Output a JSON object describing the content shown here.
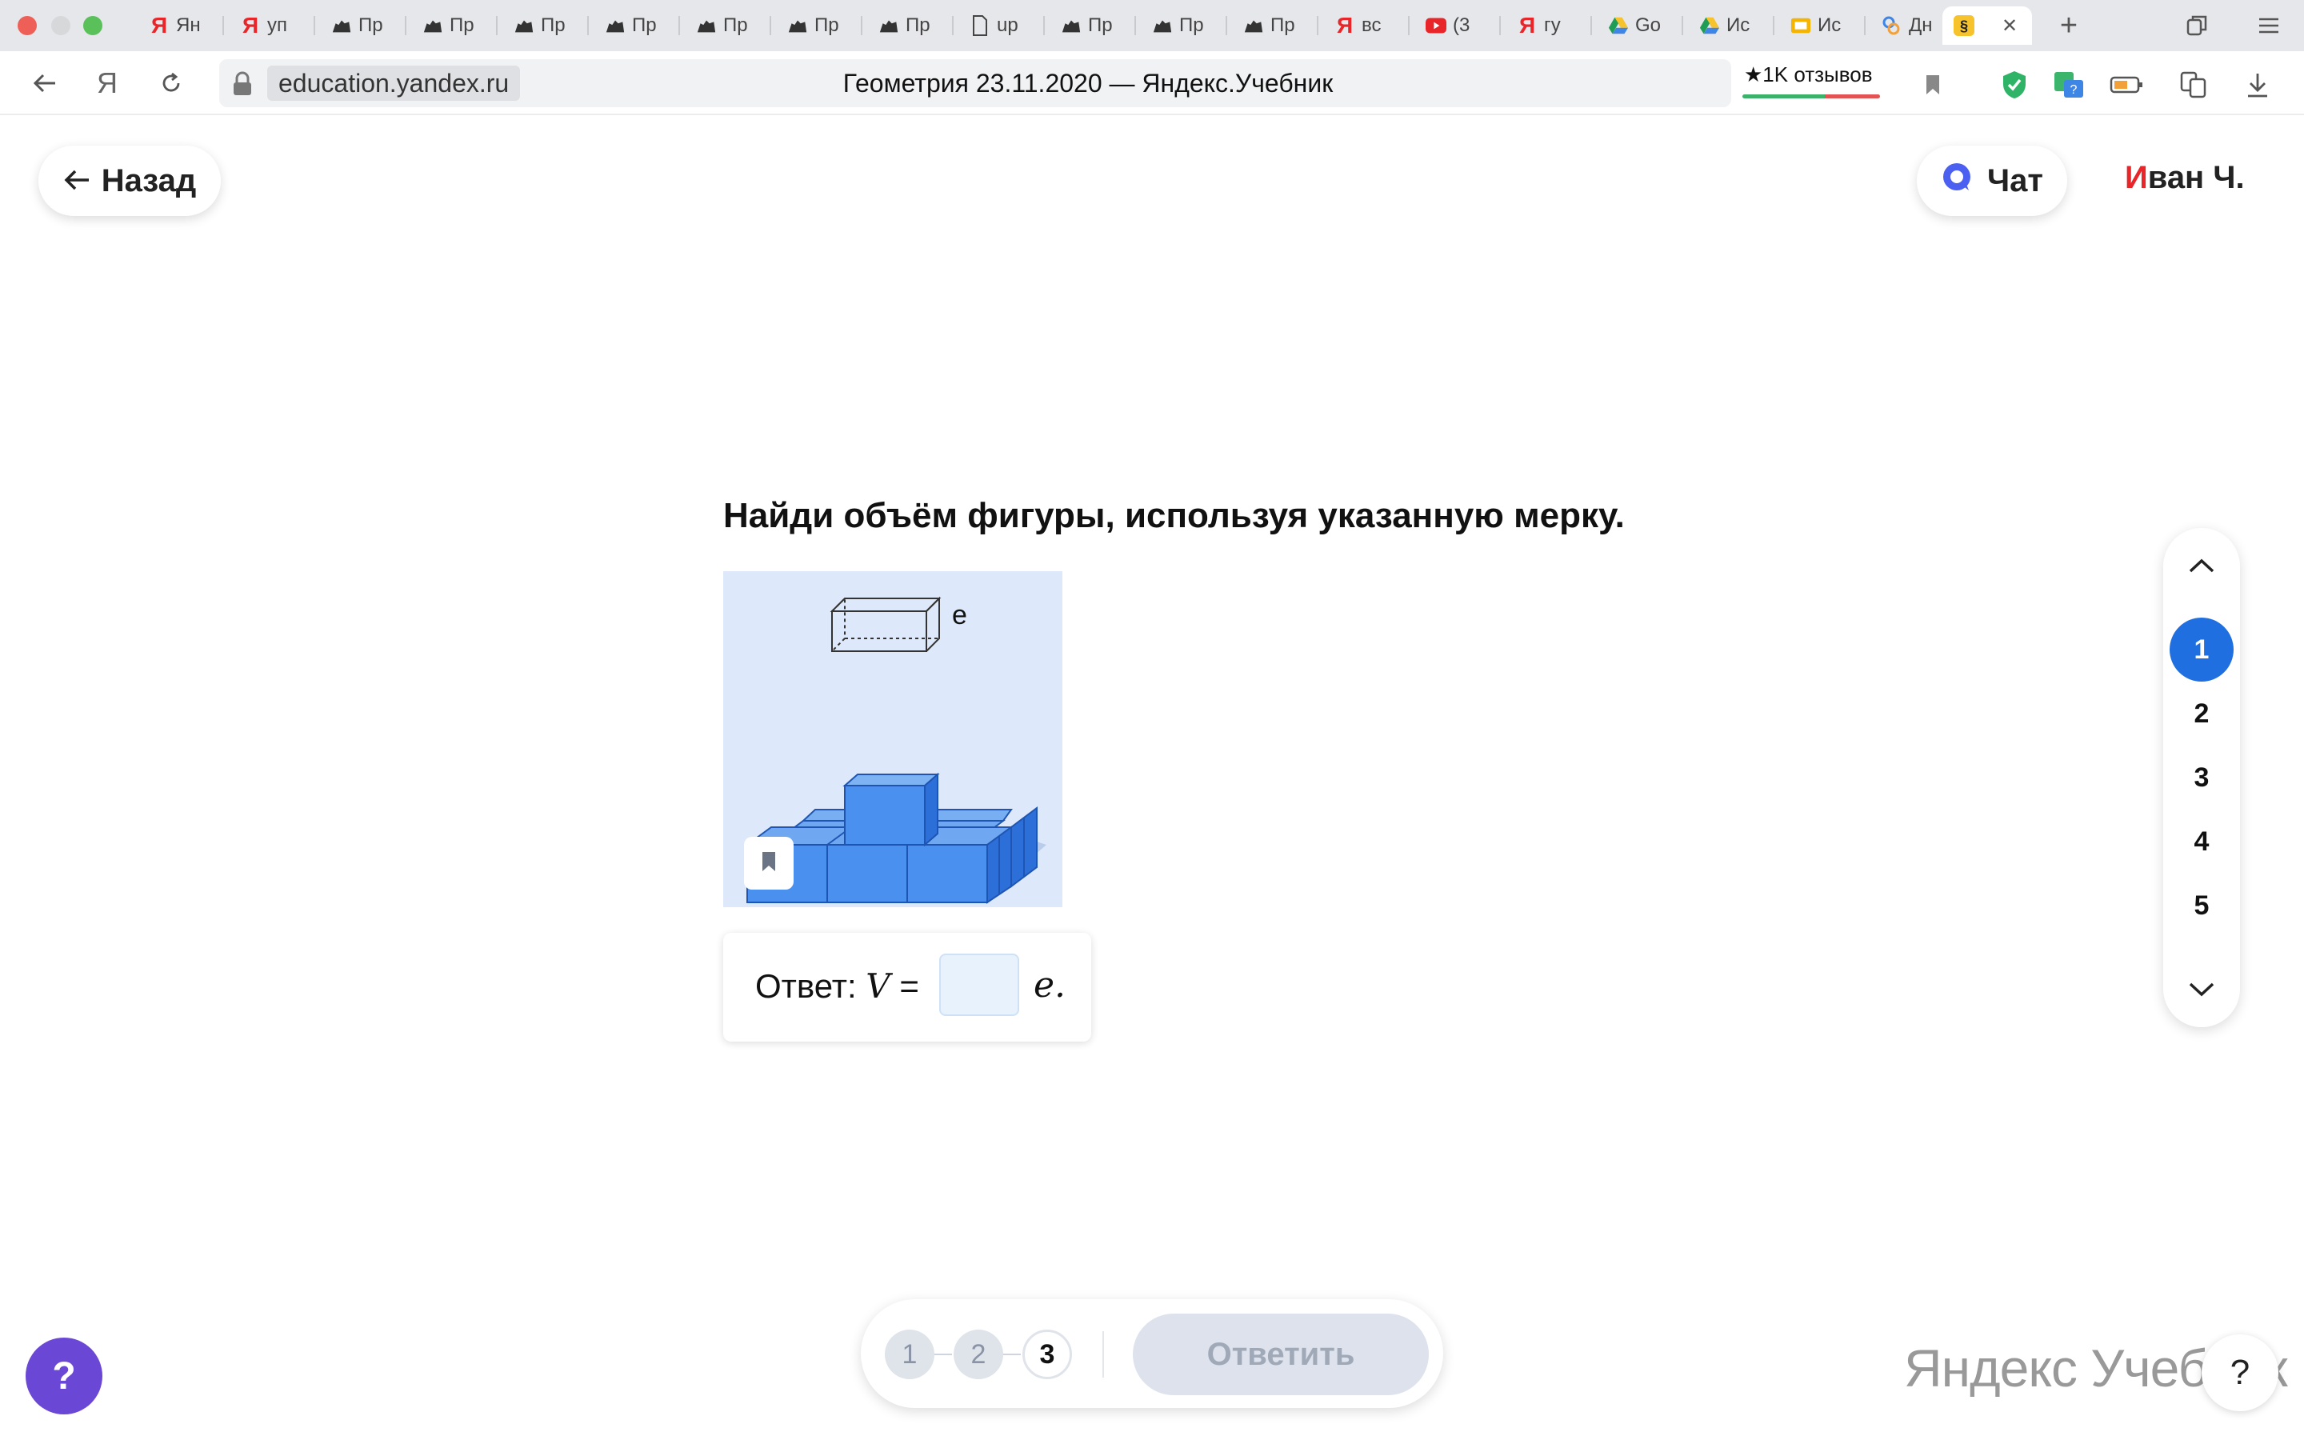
{
  "browser": {
    "tabs": [
      {
        "icon": "yandex-icon",
        "label": "Ян"
      },
      {
        "icon": "yandex-icon",
        "label": "уп"
      },
      {
        "icon": "bear-icon",
        "label": "Пр"
      },
      {
        "icon": "bear-icon",
        "label": "Пр"
      },
      {
        "icon": "bear-icon",
        "label": "Пр"
      },
      {
        "icon": "bear-icon",
        "label": "Пр"
      },
      {
        "icon": "bear-icon",
        "label": "Пр"
      },
      {
        "icon": "bear-icon",
        "label": "Пр"
      },
      {
        "icon": "bear-icon",
        "label": "Пр"
      },
      {
        "icon": "document-icon",
        "label": "up"
      },
      {
        "icon": "bear-icon",
        "label": "Пр"
      },
      {
        "icon": "bear-icon",
        "label": "Пр"
      },
      {
        "icon": "bear-icon",
        "label": "Пр"
      },
      {
        "icon": "yandex-icon",
        "label": "вс"
      },
      {
        "icon": "youtube-icon",
        "label": "(3"
      },
      {
        "icon": "yandex-icon",
        "label": "гу"
      },
      {
        "icon": "google-drive-icon",
        "label": "Go"
      },
      {
        "icon": "google-drive-icon",
        "label": "Ис"
      },
      {
        "icon": "slides-icon",
        "label": "Ис"
      },
      {
        "icon": "diary-icon",
        "label": "Дн"
      },
      {
        "icon": "section-icon",
        "label": "",
        "active": true
      }
    ],
    "new_tab_label": "+",
    "address": {
      "domain": "education.yandex.ru",
      "page_title": "Геометрия 23.11.2020 — Яндекс.Учебник",
      "reviews": "★1K отзывов"
    }
  },
  "header": {
    "back_label": "Назад",
    "chat_label": "Чат",
    "user_initial": "И",
    "user_rest": "ван Ч."
  },
  "task": {
    "title": "Найди объём фигуры, используя указанную мерку.",
    "measure_label": "e",
    "answer_prefix": "Ответ:",
    "answer_var": "V",
    "answer_eq": "=",
    "answer_value": "",
    "answer_unit": "e."
  },
  "pager": {
    "items": [
      "1",
      "2",
      "3",
      "4",
      "5"
    ],
    "active": "1"
  },
  "attempts": {
    "items": [
      "1",
      "2",
      "3"
    ],
    "current": "3",
    "submit_label": "Ответить"
  },
  "footer": {
    "help_label": "?",
    "brand_first": "Яндекс",
    "brand_second": "Учебник",
    "help_bottom_label": "?"
  },
  "colors": {
    "accent": "#1f6fe0",
    "help_fab": "#6b47d6",
    "yandex_red": "#e8262a",
    "cube_blue": "#3d86e6"
  }
}
